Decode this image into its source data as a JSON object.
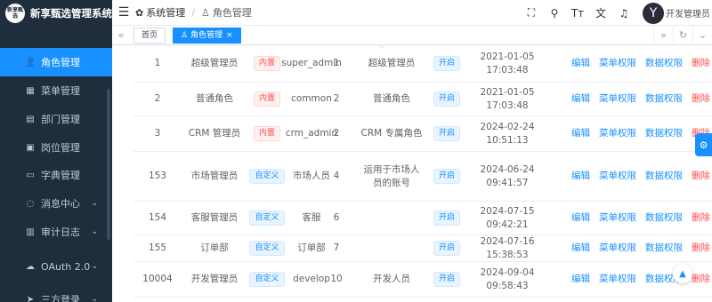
{
  "app": {
    "title": "新享甄选管理系统",
    "logo_text": "新享甄选"
  },
  "sidebar": {
    "items": [
      {
        "label": "角色管理",
        "icon": "user-icon",
        "glyph": "👤",
        "active": true
      },
      {
        "label": "菜单管理",
        "icon": "grid-icon",
        "glyph": "▦"
      },
      {
        "label": "部门管理",
        "icon": "tree-icon",
        "glyph": "▤"
      },
      {
        "label": "岗位管理",
        "icon": "post-icon",
        "glyph": "▣"
      },
      {
        "label": "字典管理",
        "icon": "dict-icon",
        "glyph": "▭"
      },
      {
        "label": "消息中心",
        "icon": "message-icon",
        "glyph": "◌",
        "expandable": true
      },
      {
        "label": "审计日志",
        "icon": "log-icon",
        "glyph": "▥",
        "expandable": true
      },
      {
        "label": "OAuth 2.0",
        "icon": "cloud-icon",
        "glyph": "☁",
        "expandable": true
      },
      {
        "label": "三方登录",
        "icon": "rocket-icon",
        "glyph": "➤",
        "expandable": true
      }
    ]
  },
  "header": {
    "breadcrumb": [
      {
        "label": "系统管理",
        "icon": "gear-icon"
      },
      {
        "label": "角色管理",
        "icon": "user-icon"
      }
    ],
    "user_name": "开发管理员"
  },
  "tags": [
    {
      "label": "首页",
      "active": false
    },
    {
      "label": "角色管理",
      "active": true
    }
  ],
  "table": {
    "rows": [
      {
        "id": "1",
        "name": "超级管理员",
        "type": "内置",
        "type_kind": "builtin",
        "code": "super_admin",
        "sort": "1",
        "remark": "超级管理员",
        "status": "开启",
        "created": "2021-01-05 17:03:48"
      },
      {
        "id": "2",
        "name": "普通角色",
        "type": "内置",
        "type_kind": "builtin",
        "code": "common",
        "sort": "2",
        "remark": "普通角色",
        "status": "开启",
        "created": "2021-01-05 17:03:48"
      },
      {
        "id": "3",
        "name": "CRM 管理员",
        "type": "内置",
        "type_kind": "builtin",
        "code": "crm_admin",
        "sort": "2",
        "remark": "CRM 专属角色",
        "status": "开启",
        "created": "2024-02-24 10:51:13"
      },
      {
        "id": "153",
        "name": "市场管理员",
        "type": "自定义",
        "type_kind": "custom",
        "code": "市场人员",
        "sort": "4",
        "remark": "运用于市场人员的账号",
        "status": "开启",
        "created": "2024-06-24 09:41:57"
      },
      {
        "id": "154",
        "name": "客服管理员",
        "type": "自定义",
        "type_kind": "custom",
        "code": "客服",
        "sort": "6",
        "remark": "",
        "status": "开启",
        "created": "2024-07-15 09:42:21"
      },
      {
        "id": "155",
        "name": "订单部",
        "type": "自定义",
        "type_kind": "custom",
        "code": "订单部",
        "sort": "7",
        "remark": "",
        "status": "开启",
        "created": "2024-07-16 15:38:53"
      },
      {
        "id": "10004",
        "name": "开发管理员",
        "type": "自定义",
        "type_kind": "custom",
        "code": "develop",
        "sort": "10",
        "remark": "开发人员",
        "status": "开启",
        "created": "2024-09-04 09:58:43"
      }
    ],
    "actions": [
      "编辑",
      "菜单权限",
      "数据权限",
      "删除"
    ]
  },
  "colors": {
    "primary": "#1890ff",
    "danger": "#ff4d4f",
    "sidebar_bg": "#1f2d3d"
  }
}
